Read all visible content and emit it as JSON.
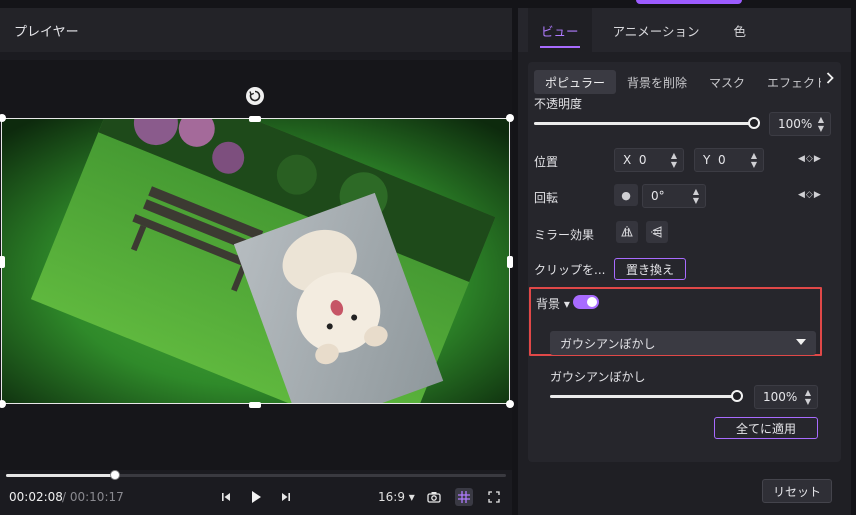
{
  "player": {
    "title": "プレイヤー",
    "current_time": "00:02:08",
    "total_time": "/ 00:10:17",
    "aspect_ratio": "16:9",
    "progress": 0.22,
    "icons": [
      "previous-frame-icon",
      "play-icon",
      "next-frame-icon",
      "camera-icon",
      "crop-grid-icon",
      "fullscreen-icon"
    ]
  },
  "inspector": {
    "tabs": [
      {
        "label": "ビュー",
        "active": true
      },
      {
        "label": "アニメーション",
        "active": false
      },
      {
        "label": "色",
        "active": false
      }
    ],
    "subtabs": [
      {
        "label": "ポピュラー",
        "active": true
      },
      {
        "label": "背景を削除",
        "active": false
      },
      {
        "label": "マスク",
        "active": false
      },
      {
        "label": "エフェクト",
        "active": false
      }
    ],
    "opacity": {
      "label": "不透明度",
      "value": "100%",
      "level": 1.0
    },
    "position": {
      "label": "位置",
      "x_label": "X",
      "x_value": "0",
      "y_label": "Y",
      "y_value": "0"
    },
    "rotation": {
      "label": "回転",
      "value": "0°"
    },
    "mirror": {
      "label": "ミラー効果"
    },
    "clip": {
      "label": "クリップを...",
      "replace_label": "置き換え"
    },
    "background": {
      "label": "背景",
      "enabled": true,
      "dropdown_value": "ガウシアンぼかし",
      "blur_label": "ガウシアンぼかし",
      "blur_value": "100%",
      "blur_level": 1.0,
      "apply_all_label": "全てに適用"
    },
    "reset_label": "リセット"
  },
  "colors": {
    "accent": "#a86bff",
    "highlight_border": "#e04848",
    "panel_bg": "#1f1f24"
  }
}
